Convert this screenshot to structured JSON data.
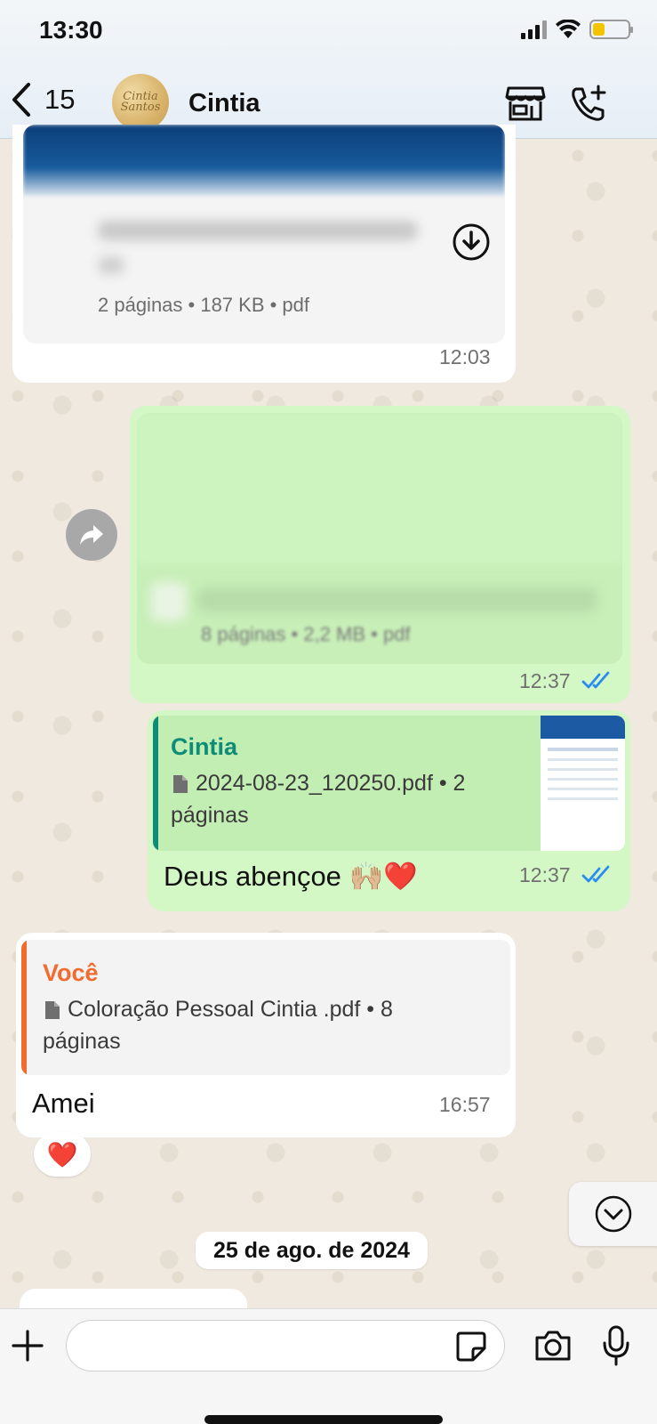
{
  "status_bar": {
    "time": "13:30"
  },
  "header": {
    "back_count": "15",
    "avatar_text": "Cintia Santos",
    "contact_name": "Cintia"
  },
  "messages": {
    "m1": {
      "doc_meta": "2 páginas • 187 KB • pdf",
      "time": "12:03"
    },
    "m2": {
      "doc_meta": "8 páginas • 2,2 MB • pdf",
      "time": "12:37"
    },
    "m3": {
      "quote_author": "Cintia",
      "quote_file": "2024-08-23_120250.pdf • 2 páginas",
      "text": "Deus abençoe 🙌🏼❤️",
      "time": "12:37"
    },
    "m4": {
      "quote_author": "Você",
      "quote_file": "Coloração Pessoal Cintia .pdf • 8 páginas",
      "text": "Amei",
      "time": "16:57",
      "reaction": "❤️"
    }
  },
  "date_separator": "25 de ago. de 2024",
  "input": {
    "placeholder": ""
  },
  "colors": {
    "outgoing_bubble": "#d3f8c5",
    "incoming_bubble": "#ffffff",
    "read_ticks": "#2a8bf2",
    "quote_accent_outgoing": "#0d8c77",
    "quote_accent_incoming": "#f26a2e"
  }
}
